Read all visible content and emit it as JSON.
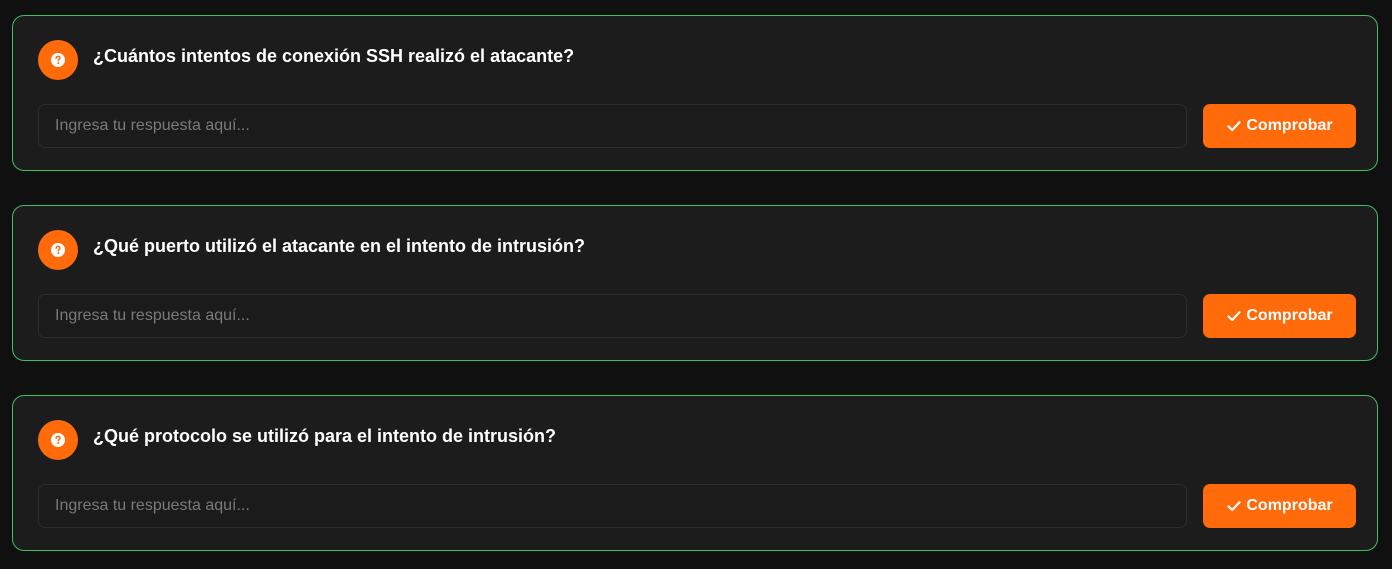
{
  "colors": {
    "background": "#101010",
    "card_background": "#1c1c1c",
    "card_border": "#3fbf63",
    "accent": "#ff6a0b",
    "text": "#ffffff",
    "placeholder": "#7a7a7a"
  },
  "icons": {
    "question": "question-circle-icon",
    "check": "check-icon"
  },
  "questions": [
    {
      "title": "¿Cuántos intentos de conexión SSH realizó el atacante?",
      "input_placeholder": "Ingresa tu respuesta aquí...",
      "input_value": "",
      "button_label": "Comprobar"
    },
    {
      "title": "¿Qué puerto utilizó el atacante en el intento de intrusión?",
      "input_placeholder": "Ingresa tu respuesta aquí...",
      "input_value": "",
      "button_label": "Comprobar"
    },
    {
      "title": "¿Qué protocolo se utilizó para el intento de intrusión?",
      "input_placeholder": "Ingresa tu respuesta aquí...",
      "input_value": "",
      "button_label": "Comprobar"
    }
  ]
}
